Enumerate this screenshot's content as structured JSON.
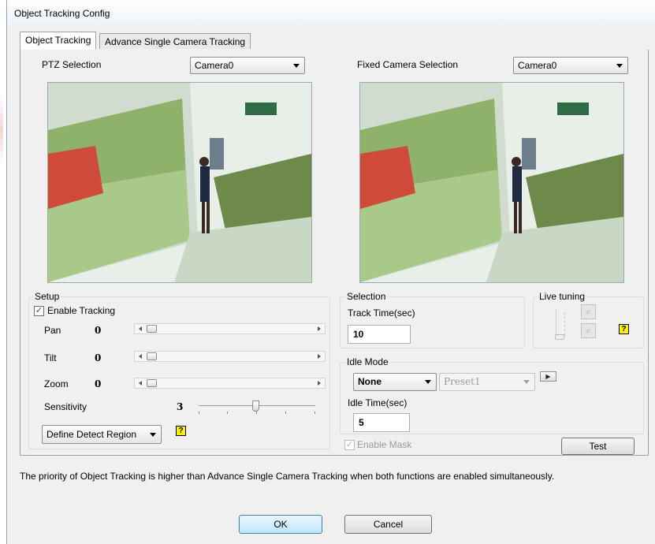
{
  "window": {
    "title": "Object Tracking Config"
  },
  "tabs": [
    {
      "label": "Object Tracking",
      "active": true
    },
    {
      "label": "Advance Single Camera Tracking",
      "active": false
    }
  ],
  "ptz": {
    "label": "PTZ Selection",
    "camera": "Camera0"
  },
  "fixed": {
    "label": "Fixed Camera Selection",
    "camera": "Camera0"
  },
  "setup": {
    "title": "Setup",
    "enable_tracking": {
      "label": "Enable Tracking",
      "checked": true
    },
    "pan": {
      "label": "Pan",
      "value": "0"
    },
    "tilt": {
      "label": "Tilt",
      "value": "0"
    },
    "zoom": {
      "label": "Zoom",
      "value": "0"
    },
    "sensitivity": {
      "label": "Sensitivity",
      "value": "3"
    },
    "detect_region": "Define Detect Region"
  },
  "selection": {
    "title": "Selection",
    "track_time_label": "Track Time(sec)",
    "track_time": "10"
  },
  "live_tuning": {
    "title": "Live tuning"
  },
  "idle": {
    "title": "Idle Mode",
    "mode": "None",
    "preset": "Preset1",
    "idle_time_label": "Idle Time(sec)",
    "idle_time": "5"
  },
  "enable_mask": {
    "label": "Enable Mask",
    "checked": true,
    "enabled": false
  },
  "test_button": "Test",
  "note": "The priority of Object Tracking is higher than Advance Single Camera Tracking when both functions are enabled simultaneously.",
  "buttons": {
    "ok": "OK",
    "cancel": "Cancel"
  },
  "icons": {
    "help": "?",
    "checkmark": "✓",
    "magnifier": "⌕",
    "play": "▶"
  },
  "colors": {
    "help_bg": "#fff200",
    "accent": "#3c7fb1"
  }
}
